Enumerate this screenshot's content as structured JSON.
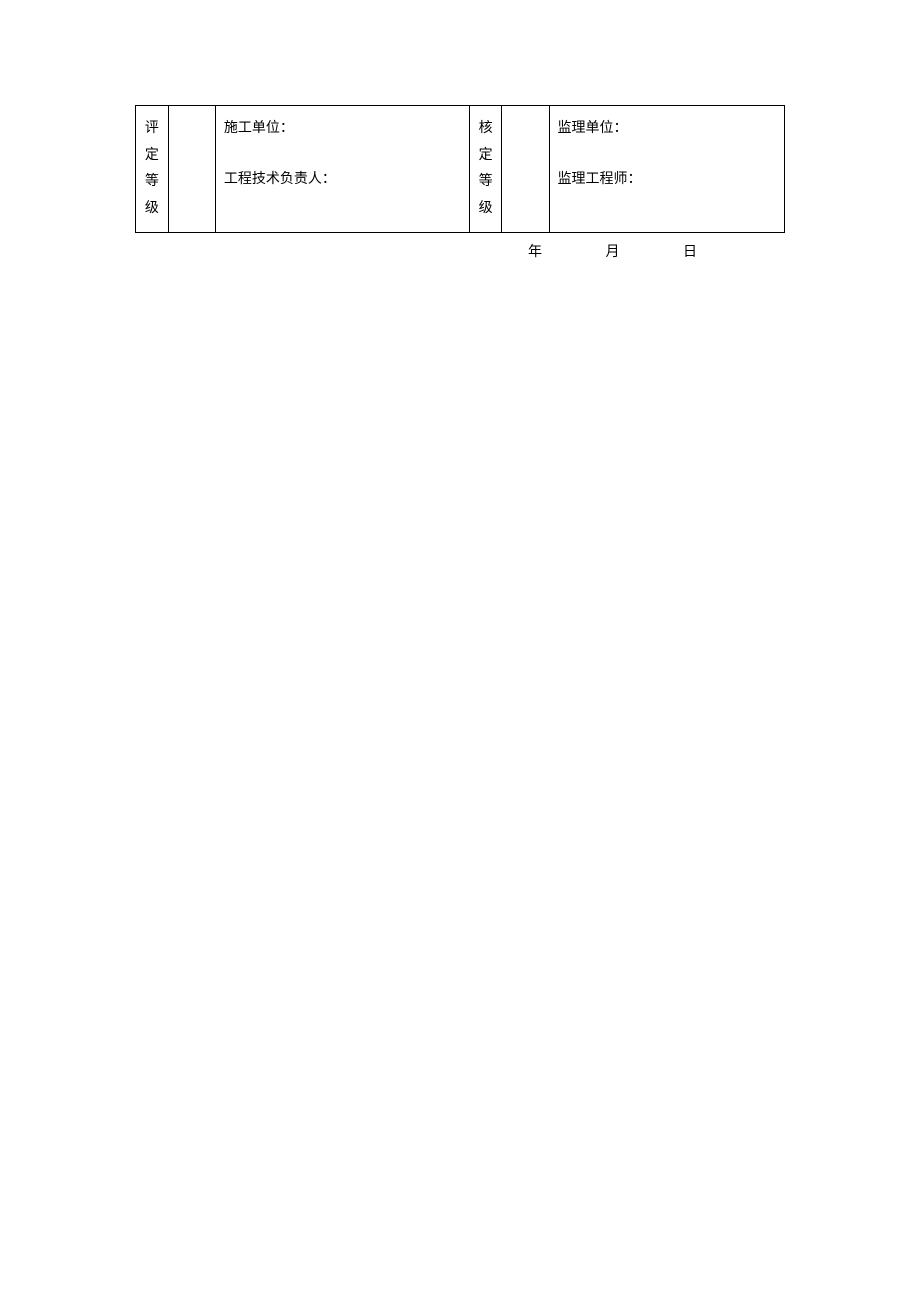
{
  "table": {
    "left_vertical": {
      "c1": "评",
      "c2": "定",
      "c3": "等",
      "c4": "级"
    },
    "left_content": {
      "line1": "施工单位：",
      "line2": "工程技术负责人："
    },
    "mid_vertical": {
      "c1": "核",
      "c2": "定",
      "c3": "等",
      "c4": "级"
    },
    "right_content": {
      "line1": "监理单位：",
      "line2": "监理工程师："
    }
  },
  "date": {
    "year": "年",
    "month": "月",
    "day": "日"
  }
}
